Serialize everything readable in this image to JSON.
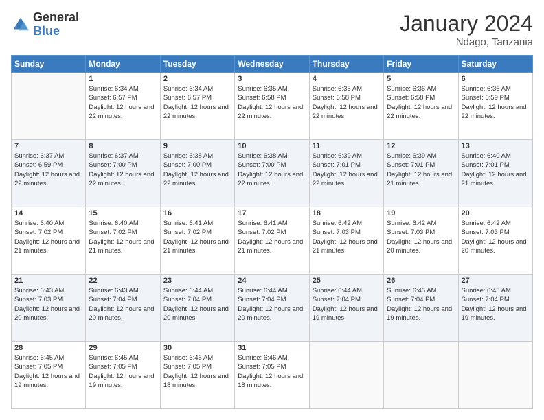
{
  "logo": {
    "general": "General",
    "blue": "Blue"
  },
  "title": "January 2024",
  "location": "Ndago, Tanzania",
  "days_header": [
    "Sunday",
    "Monday",
    "Tuesday",
    "Wednesday",
    "Thursday",
    "Friday",
    "Saturday"
  ],
  "weeks": [
    [
      {
        "day": "",
        "sunrise": "",
        "sunset": "",
        "daylight": ""
      },
      {
        "day": "1",
        "sunrise": "6:34 AM",
        "sunset": "6:57 PM",
        "daylight": "12 hours and 22 minutes."
      },
      {
        "day": "2",
        "sunrise": "6:34 AM",
        "sunset": "6:57 PM",
        "daylight": "12 hours and 22 minutes."
      },
      {
        "day": "3",
        "sunrise": "6:35 AM",
        "sunset": "6:58 PM",
        "daylight": "12 hours and 22 minutes."
      },
      {
        "day": "4",
        "sunrise": "6:35 AM",
        "sunset": "6:58 PM",
        "daylight": "12 hours and 22 minutes."
      },
      {
        "day": "5",
        "sunrise": "6:36 AM",
        "sunset": "6:58 PM",
        "daylight": "12 hours and 22 minutes."
      },
      {
        "day": "6",
        "sunrise": "6:36 AM",
        "sunset": "6:59 PM",
        "daylight": "12 hours and 22 minutes."
      }
    ],
    [
      {
        "day": "7",
        "sunrise": "6:37 AM",
        "sunset": "6:59 PM",
        "daylight": "12 hours and 22 minutes."
      },
      {
        "day": "8",
        "sunrise": "6:37 AM",
        "sunset": "7:00 PM",
        "daylight": "12 hours and 22 minutes."
      },
      {
        "day": "9",
        "sunrise": "6:38 AM",
        "sunset": "7:00 PM",
        "daylight": "12 hours and 22 minutes."
      },
      {
        "day": "10",
        "sunrise": "6:38 AM",
        "sunset": "7:00 PM",
        "daylight": "12 hours and 22 minutes."
      },
      {
        "day": "11",
        "sunrise": "6:39 AM",
        "sunset": "7:01 PM",
        "daylight": "12 hours and 22 minutes."
      },
      {
        "day": "12",
        "sunrise": "6:39 AM",
        "sunset": "7:01 PM",
        "daylight": "12 hours and 21 minutes."
      },
      {
        "day": "13",
        "sunrise": "6:40 AM",
        "sunset": "7:01 PM",
        "daylight": "12 hours and 21 minutes."
      }
    ],
    [
      {
        "day": "14",
        "sunrise": "6:40 AM",
        "sunset": "7:02 PM",
        "daylight": "12 hours and 21 minutes."
      },
      {
        "day": "15",
        "sunrise": "6:40 AM",
        "sunset": "7:02 PM",
        "daylight": "12 hours and 21 minutes."
      },
      {
        "day": "16",
        "sunrise": "6:41 AM",
        "sunset": "7:02 PM",
        "daylight": "12 hours and 21 minutes."
      },
      {
        "day": "17",
        "sunrise": "6:41 AM",
        "sunset": "7:02 PM",
        "daylight": "12 hours and 21 minutes."
      },
      {
        "day": "18",
        "sunrise": "6:42 AM",
        "sunset": "7:03 PM",
        "daylight": "12 hours and 21 minutes."
      },
      {
        "day": "19",
        "sunrise": "6:42 AM",
        "sunset": "7:03 PM",
        "daylight": "12 hours and 20 minutes."
      },
      {
        "day": "20",
        "sunrise": "6:42 AM",
        "sunset": "7:03 PM",
        "daylight": "12 hours and 20 minutes."
      }
    ],
    [
      {
        "day": "21",
        "sunrise": "6:43 AM",
        "sunset": "7:03 PM",
        "daylight": "12 hours and 20 minutes."
      },
      {
        "day": "22",
        "sunrise": "6:43 AM",
        "sunset": "7:04 PM",
        "daylight": "12 hours and 20 minutes."
      },
      {
        "day": "23",
        "sunrise": "6:44 AM",
        "sunset": "7:04 PM",
        "daylight": "12 hours and 20 minutes."
      },
      {
        "day": "24",
        "sunrise": "6:44 AM",
        "sunset": "7:04 PM",
        "daylight": "12 hours and 20 minutes."
      },
      {
        "day": "25",
        "sunrise": "6:44 AM",
        "sunset": "7:04 PM",
        "daylight": "12 hours and 19 minutes."
      },
      {
        "day": "26",
        "sunrise": "6:45 AM",
        "sunset": "7:04 PM",
        "daylight": "12 hours and 19 minutes."
      },
      {
        "day": "27",
        "sunrise": "6:45 AM",
        "sunset": "7:04 PM",
        "daylight": "12 hours and 19 minutes."
      }
    ],
    [
      {
        "day": "28",
        "sunrise": "6:45 AM",
        "sunset": "7:05 PM",
        "daylight": "12 hours and 19 minutes."
      },
      {
        "day": "29",
        "sunrise": "6:45 AM",
        "sunset": "7:05 PM",
        "daylight": "12 hours and 19 minutes."
      },
      {
        "day": "30",
        "sunrise": "6:46 AM",
        "sunset": "7:05 PM",
        "daylight": "12 hours and 18 minutes."
      },
      {
        "day": "31",
        "sunrise": "6:46 AM",
        "sunset": "7:05 PM",
        "daylight": "12 hours and 18 minutes."
      },
      {
        "day": "",
        "sunrise": "",
        "sunset": "",
        "daylight": ""
      },
      {
        "day": "",
        "sunrise": "",
        "sunset": "",
        "daylight": ""
      },
      {
        "day": "",
        "sunrise": "",
        "sunset": "",
        "daylight": ""
      }
    ]
  ]
}
